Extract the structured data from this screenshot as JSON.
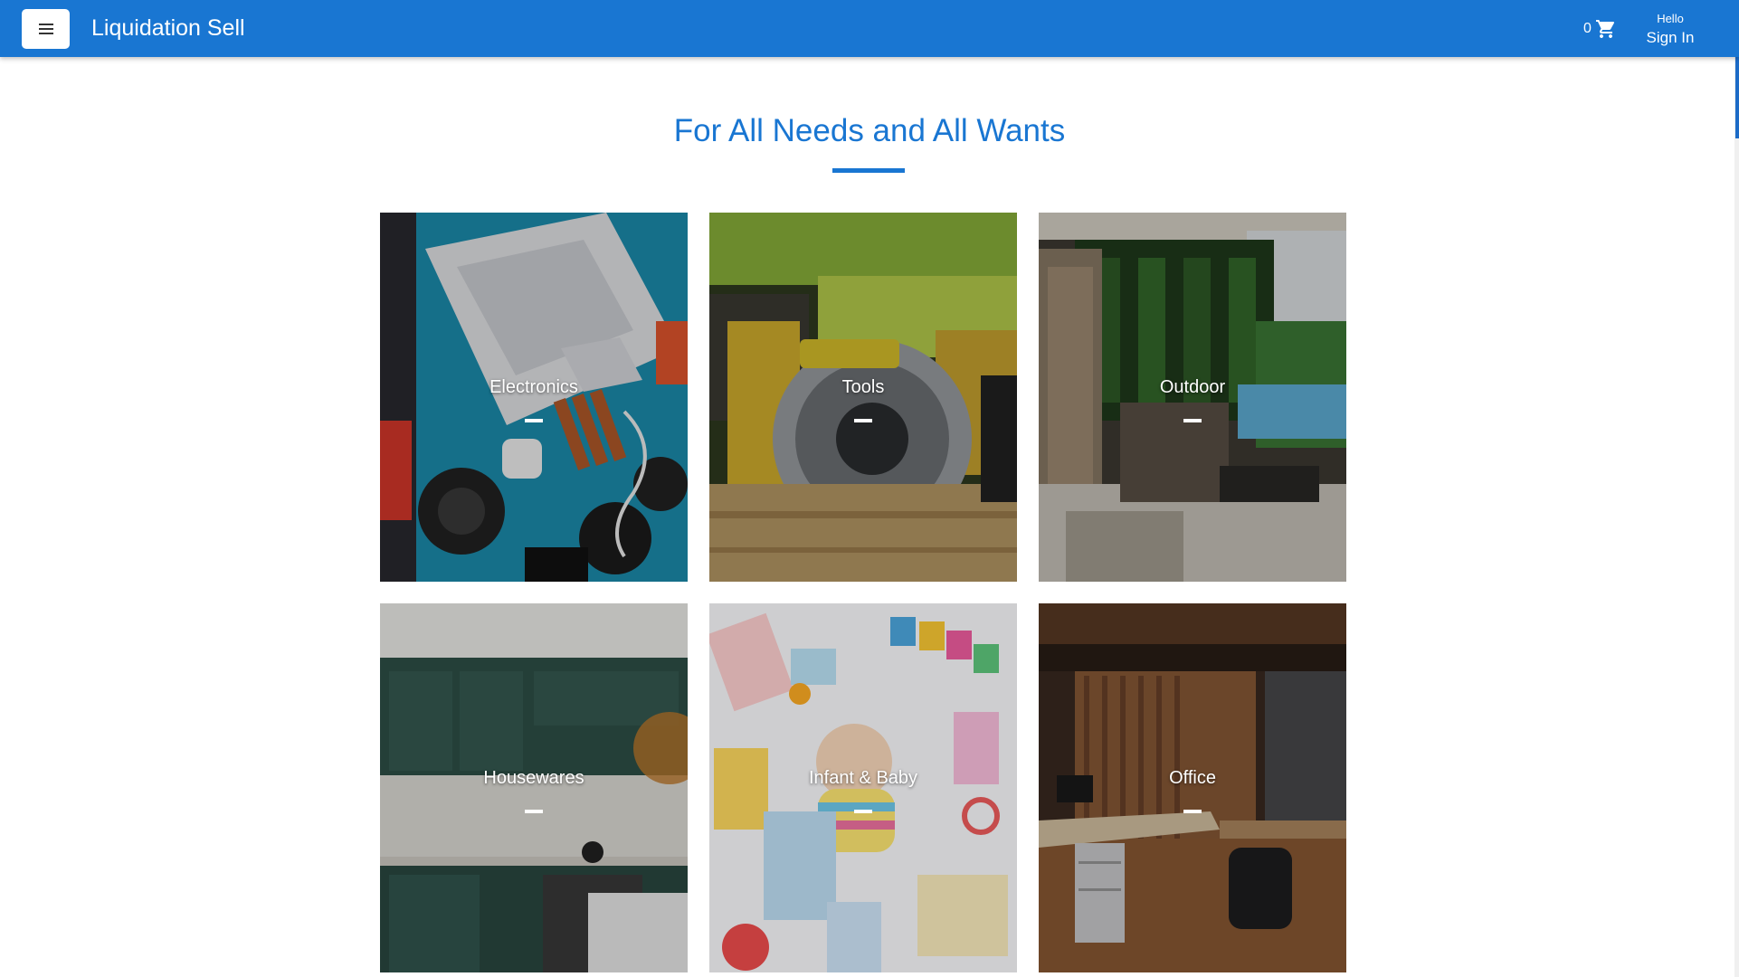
{
  "header": {
    "brand": "Liquidation Sell",
    "cart_count": "0",
    "greeting": "Hello",
    "sign_in": "Sign In",
    "bar_color": "#1976d2"
  },
  "hero": {
    "title": "For All Needs and All Wants",
    "accent_color": "#1976d2"
  },
  "categories": [
    {
      "label": "Electronics"
    },
    {
      "label": "Tools"
    },
    {
      "label": "Outdoor"
    },
    {
      "label": "Housewares"
    },
    {
      "label": "Infant & Baby"
    },
    {
      "label": "Office"
    }
  ],
  "icons": {
    "menu": "menu-icon",
    "cart": "cart-icon"
  }
}
